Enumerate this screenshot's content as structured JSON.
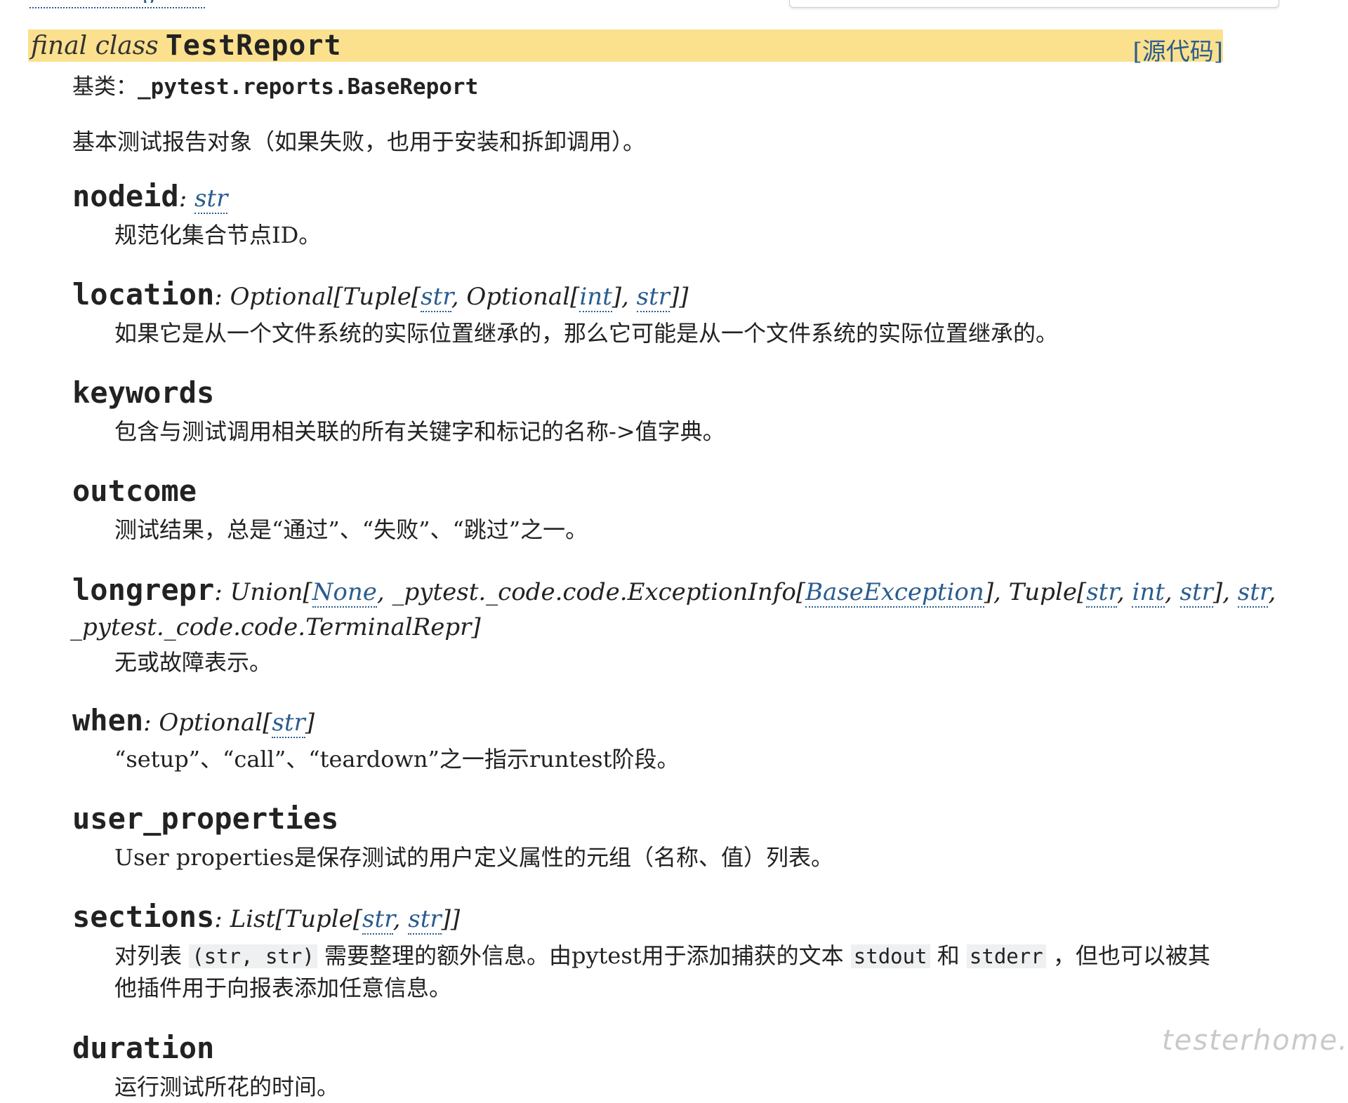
{
  "class": {
    "keyword": "final class",
    "name": "TestReport",
    "source_link": "[源代码]",
    "bases_label": "基类：",
    "bases_value": "_pytest.reports.BaseReport",
    "summary": "基本测试报告对象（如果失败，也用于安装和拆卸调用）。"
  },
  "attributes": {
    "nodeid": {
      "name": "nodeid",
      "sep": ": ",
      "type": "str",
      "desc": "规范化集合节点ID。"
    },
    "location": {
      "name": "location",
      "sep": ": ",
      "t1": "Optional[Tuple[",
      "r1": "str",
      "t2": ", Optional[",
      "r2": "int",
      "t3": "], ",
      "r3": "str",
      "t4": "]]",
      "desc": "如果它是从一个文件系统的实际位置继承的，那么它可能是从一个文件系统的实际位置继承的。"
    },
    "keywords": {
      "name": "keywords",
      "desc": "包含与测试调用相关联的所有关键字和标记的名称->值字典。"
    },
    "outcome": {
      "name": "outcome",
      "desc": "测试结果，总是“通过”、“失败”、“跳过”之一。"
    },
    "longrepr": {
      "name": "longrepr",
      "sep": ": ",
      "t1": "Union[",
      "r1": "None",
      "t2": ", _pytest._code.code.ExceptionInfo[",
      "r2": "BaseException",
      "t3": "], Tuple[",
      "r3": "str",
      "t4": ", ",
      "r4": "int",
      "t5": ", ",
      "r5": "str",
      "t6": "], ",
      "r6": "str",
      "t7": ",",
      "line2": "_pytest._code.code.TerminalRepr]",
      "desc": "无或故障表示。"
    },
    "when": {
      "name": "when",
      "sep": ": ",
      "t1": "Optional[",
      "r1": "str",
      "t2": "]",
      "desc": "“setup”、“call”、“teardown”之一指示runtest阶段。"
    },
    "user_properties": {
      "name": "user_properties",
      "desc": "User properties是保存测试的用户定义属性的元组（名称、值）列表。"
    },
    "sections": {
      "name": "sections",
      "sep": ": ",
      "t1": "List[Tuple[",
      "r1": "str",
      "t2": ", ",
      "r2": "str",
      "t3": "]]",
      "desc_a": "对列表 ",
      "code1": "(str, str)",
      "desc_b": " 需要整理的额外信息。由pytest用于添加捕获的文本 ",
      "code2": "stdout",
      "desc_c": " 和 ",
      "code3": "stderr",
      "desc_d": " ，但也可以被其",
      "desc_line2": "他插件用于向报表添加任意信息。"
    },
    "duration": {
      "name": "duration",
      "desc_partial": "运行测试所花的时间。"
    }
  },
  "watermark": "testerhome.com",
  "colors": {
    "signature_bg": "#fbe08e",
    "link": "#2a5d8f",
    "text": "#222222"
  }
}
